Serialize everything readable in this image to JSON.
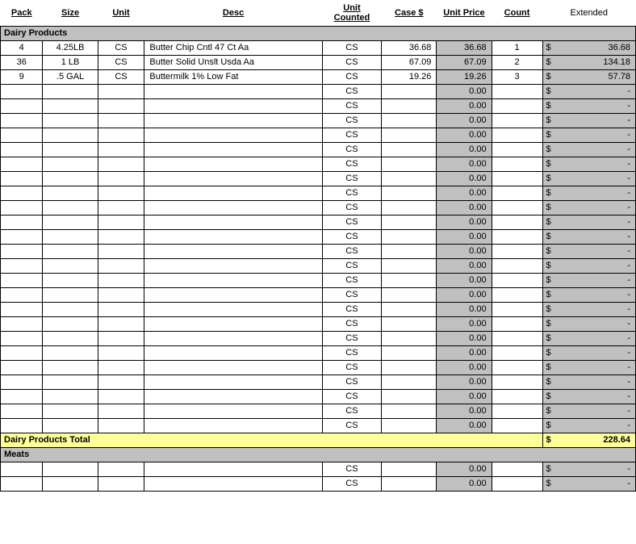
{
  "headers": {
    "pack": "Pack",
    "size": "Size",
    "unit": "Unit",
    "desc": "Desc",
    "unit_counted": "Unit Counted",
    "case": "Case $",
    "unit_price": "Unit Price",
    "count": "Count",
    "extended": "Extended"
  },
  "sections": [
    {
      "name": "Dairy Products",
      "total_label": "Dairy Products Total",
      "total_value": "228.64",
      "rows": [
        {
          "pack": "4",
          "size": "4.25LB",
          "unit": "CS",
          "desc": "Butter Chip Cntl 47 Ct Aa",
          "unit_counted": "CS",
          "case": "36.68",
          "unit_price": "36.68",
          "count": "1",
          "extended": "36.68"
        },
        {
          "pack": "36",
          "size": "1 LB",
          "unit": "CS",
          "desc": "Butter Solid Unslt Usda Aa",
          "unit_counted": "CS",
          "case": "67.09",
          "unit_price": "67.09",
          "count": "2",
          "extended": "134.18"
        },
        {
          "pack": "9",
          "size": ".5 GAL",
          "unit": "CS",
          "desc": "Buttermilk 1% Low Fat",
          "unit_counted": "CS",
          "case": "19.26",
          "unit_price": "19.26",
          "count": "3",
          "extended": "57.78"
        },
        {
          "pack": "",
          "size": "",
          "unit": "",
          "desc": "",
          "unit_counted": "CS",
          "case": "",
          "unit_price": "0.00",
          "count": "",
          "extended": "-"
        },
        {
          "pack": "",
          "size": "",
          "unit": "",
          "desc": "",
          "unit_counted": "CS",
          "case": "",
          "unit_price": "0.00",
          "count": "",
          "extended": "-"
        },
        {
          "pack": "",
          "size": "",
          "unit": "",
          "desc": "",
          "unit_counted": "CS",
          "case": "",
          "unit_price": "0.00",
          "count": "",
          "extended": "-"
        },
        {
          "pack": "",
          "size": "",
          "unit": "",
          "desc": "",
          "unit_counted": "CS",
          "case": "",
          "unit_price": "0.00",
          "count": "",
          "extended": "-"
        },
        {
          "pack": "",
          "size": "",
          "unit": "",
          "desc": "",
          "unit_counted": "CS",
          "case": "",
          "unit_price": "0.00",
          "count": "",
          "extended": "-"
        },
        {
          "pack": "",
          "size": "",
          "unit": "",
          "desc": "",
          "unit_counted": "CS",
          "case": "",
          "unit_price": "0.00",
          "count": "",
          "extended": "-"
        },
        {
          "pack": "",
          "size": "",
          "unit": "",
          "desc": "",
          "unit_counted": "CS",
          "case": "",
          "unit_price": "0.00",
          "count": "",
          "extended": "-"
        },
        {
          "pack": "",
          "size": "",
          "unit": "",
          "desc": "",
          "unit_counted": "CS",
          "case": "",
          "unit_price": "0.00",
          "count": "",
          "extended": "-"
        },
        {
          "pack": "",
          "size": "",
          "unit": "",
          "desc": "",
          "unit_counted": "CS",
          "case": "",
          "unit_price": "0.00",
          "count": "",
          "extended": "-"
        },
        {
          "pack": "",
          "size": "",
          "unit": "",
          "desc": "",
          "unit_counted": "CS",
          "case": "",
          "unit_price": "0.00",
          "count": "",
          "extended": "-"
        },
        {
          "pack": "",
          "size": "",
          "unit": "",
          "desc": "",
          "unit_counted": "CS",
          "case": "",
          "unit_price": "0.00",
          "count": "",
          "extended": "-"
        },
        {
          "pack": "",
          "size": "",
          "unit": "",
          "desc": "",
          "unit_counted": "CS",
          "case": "",
          "unit_price": "0.00",
          "count": "",
          "extended": "-"
        },
        {
          "pack": "",
          "size": "",
          "unit": "",
          "desc": "",
          "unit_counted": "CS",
          "case": "",
          "unit_price": "0.00",
          "count": "",
          "extended": "-"
        },
        {
          "pack": "",
          "size": "",
          "unit": "",
          "desc": "",
          "unit_counted": "CS",
          "case": "",
          "unit_price": "0.00",
          "count": "",
          "extended": "-"
        },
        {
          "pack": "",
          "size": "",
          "unit": "",
          "desc": "",
          "unit_counted": "CS",
          "case": "",
          "unit_price": "0.00",
          "count": "",
          "extended": "-"
        },
        {
          "pack": "",
          "size": "",
          "unit": "",
          "desc": "",
          "unit_counted": "CS",
          "case": "",
          "unit_price": "0.00",
          "count": "",
          "extended": "-"
        },
        {
          "pack": "",
          "size": "",
          "unit": "",
          "desc": "",
          "unit_counted": "CS",
          "case": "",
          "unit_price": "0.00",
          "count": "",
          "extended": "-"
        },
        {
          "pack": "",
          "size": "",
          "unit": "",
          "desc": "",
          "unit_counted": "CS",
          "case": "",
          "unit_price": "0.00",
          "count": "",
          "extended": "-"
        },
        {
          "pack": "",
          "size": "",
          "unit": "",
          "desc": "",
          "unit_counted": "CS",
          "case": "",
          "unit_price": "0.00",
          "count": "",
          "extended": "-"
        },
        {
          "pack": "",
          "size": "",
          "unit": "",
          "desc": "",
          "unit_counted": "CS",
          "case": "",
          "unit_price": "0.00",
          "count": "",
          "extended": "-"
        },
        {
          "pack": "",
          "size": "",
          "unit": "",
          "desc": "",
          "unit_counted": "CS",
          "case": "",
          "unit_price": "0.00",
          "count": "",
          "extended": "-"
        },
        {
          "pack": "",
          "size": "",
          "unit": "",
          "desc": "",
          "unit_counted": "CS",
          "case": "",
          "unit_price": "0.00",
          "count": "",
          "extended": "-"
        },
        {
          "pack": "",
          "size": "",
          "unit": "",
          "desc": "",
          "unit_counted": "CS",
          "case": "",
          "unit_price": "0.00",
          "count": "",
          "extended": "-"
        },
        {
          "pack": "",
          "size": "",
          "unit": "",
          "desc": "",
          "unit_counted": "CS",
          "case": "",
          "unit_price": "0.00",
          "count": "",
          "extended": "-"
        }
      ]
    },
    {
      "name": "Meats",
      "rows": [
        {
          "pack": "",
          "size": "",
          "unit": "",
          "desc": "",
          "unit_counted": "CS",
          "case": "",
          "unit_price": "0.00",
          "count": "",
          "extended": "-"
        },
        {
          "pack": "",
          "size": "",
          "unit": "",
          "desc": "",
          "unit_counted": "CS",
          "case": "",
          "unit_price": "0.00",
          "count": "",
          "extended": "-"
        }
      ]
    }
  ],
  "currency": "$"
}
